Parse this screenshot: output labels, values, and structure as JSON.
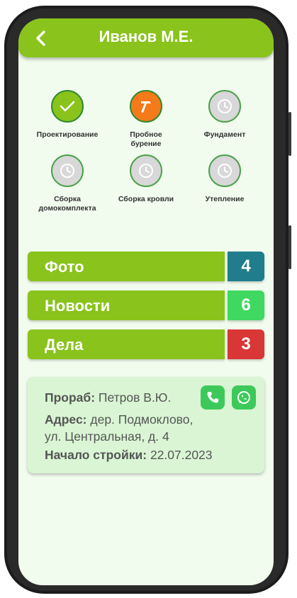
{
  "header": {
    "title": "Иванов М.Е.",
    "back_icon": "chevron-left-icon"
  },
  "stages": [
    {
      "label": "Проектирование",
      "status": "done",
      "icon": "check-icon"
    },
    {
      "label": "Пробное бурение",
      "status": "active",
      "icon": "hammer-icon"
    },
    {
      "label": "Фундамент",
      "status": "pending",
      "icon": "clock-icon"
    },
    {
      "label": "Сборка домокомплекта",
      "status": "pending",
      "icon": "clock-icon"
    },
    {
      "label": "Сборка кровли",
      "status": "pending",
      "icon": "clock-icon"
    },
    {
      "label": "Утепление",
      "status": "pending",
      "icon": "clock-icon"
    }
  ],
  "sections": [
    {
      "label": "Фото",
      "count": "4",
      "color": "#1f7d8c"
    },
    {
      "label": "Новости",
      "count": "6",
      "color": "#3fd860"
    },
    {
      "label": "Дела",
      "count": "3",
      "color": "#d93636"
    }
  ],
  "info": {
    "foreman_label": "Прораб:",
    "foreman_value": "Петров В.Ю.",
    "address_label": "Адрес:",
    "address_value_1": "дер. Подмоклово,",
    "address_value_2": "ул. Центральная, д. 4",
    "start_label": "Начало стройки:",
    "start_value": "22.07.2023",
    "call_icon": "phone-icon",
    "chat_icon": "whatsapp-icon"
  },
  "colors": {
    "accent": "#8ac31c",
    "background": "#f1fcee"
  }
}
